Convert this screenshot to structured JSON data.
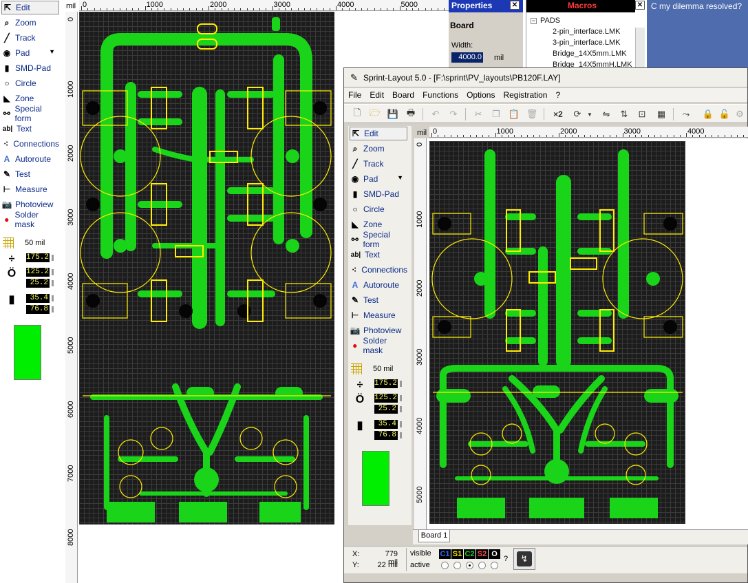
{
  "left_editor": {
    "ruler_unit": "mil",
    "ruler_h_labels": [
      "0",
      "1000",
      "2000",
      "3000",
      "4000",
      "5000"
    ],
    "ruler_v_labels": [
      "0",
      "1000",
      "2000",
      "3000",
      "4000",
      "5000",
      "6000",
      "7000",
      "8000"
    ]
  },
  "toolbox": {
    "items": [
      {
        "label": "Edit",
        "icon": "cursor-arrow-icon"
      },
      {
        "label": "Zoom",
        "icon": "magnifier-icon"
      },
      {
        "label": "Track",
        "icon": "track-icon"
      },
      {
        "label": "Pad",
        "icon": "pad-icon"
      },
      {
        "label": "SMD-Pad",
        "icon": "smd-pad-icon"
      },
      {
        "label": "Circle",
        "icon": "circle-icon"
      },
      {
        "label": "Zone",
        "icon": "zone-icon"
      },
      {
        "label": "Special form",
        "icon": "special-form-icon"
      },
      {
        "label": "Text",
        "icon": "text-icon"
      },
      {
        "label": "Connections",
        "icon": "connections-icon"
      },
      {
        "label": "Autoroute",
        "icon": "autoroute-icon"
      },
      {
        "label": "Test",
        "icon": "test-probe-icon"
      },
      {
        "label": "Measure",
        "icon": "measure-icon"
      },
      {
        "label": "Photoview",
        "icon": "camera-icon"
      },
      {
        "label": "Solder mask",
        "icon": "solder-mask-icon"
      }
    ],
    "grid": "50 mil",
    "track_width": "175.2",
    "pad_outer": "125.2",
    "pad_inner": "25.2",
    "smd_width": "35.4",
    "smd_height": "76.8",
    "accent_color": "#00ee00"
  },
  "properties_panel": {
    "title": "Properties",
    "section": "Board",
    "width_label": "Width:",
    "width_value": "4000.0",
    "width_unit": "mil"
  },
  "macros_panel": {
    "title": "Macros",
    "root": "PADS",
    "items": [
      "2-pin_interface.LMK",
      "3-pin_interface.LMK",
      "Bridge_14X5mm.LMK",
      "Bridge_14X5mmH.LMK"
    ]
  },
  "background_window": {
    "title_fragment": "C my dilemma resolved?"
  },
  "main_window": {
    "title": "Sprint-Layout 5.0 - [F:\\sprint\\PV_layouts\\PB120F.LAY]",
    "menu": [
      "File",
      "Edit",
      "Board",
      "Functions",
      "Options",
      "Registration",
      "?"
    ],
    "ruler_unit": "mil",
    "ruler_h_labels": [
      "0",
      "1000",
      "2000",
      "3000",
      "4000"
    ],
    "ruler_v_labels": [
      "0",
      "1000",
      "2000",
      "3000",
      "4000",
      "5000"
    ],
    "tab": "Board 1",
    "status": {
      "x_label": "X:",
      "x_value": "779 mil",
      "y_label": "Y:",
      "y_value": "22 mil",
      "visible_label": "visible",
      "active_label": "active",
      "layers": [
        "C1",
        "S1",
        "C2",
        "S2",
        "O"
      ],
      "help": "?"
    }
  }
}
